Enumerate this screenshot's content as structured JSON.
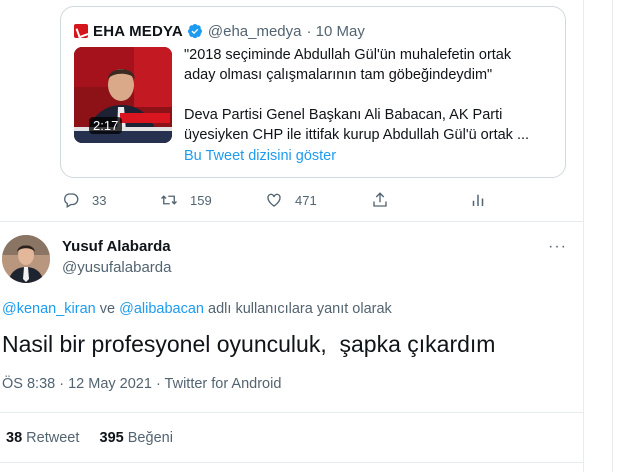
{
  "quoted": {
    "display_name": "EHA MEDYA",
    "handle": "@eha_medya",
    "date": "· 10 May",
    "video_duration": "2:17",
    "lines": [
      "\"2018 seçiminde Abdullah Gül'ün muhalefetin ortak",
      "aday olması çalışmalarının tam göbeğindeydim\"",
      "Deva Partisi Genel Başkanı Ali Babacan, AK Parti",
      "üyesiyken CHP ile ittifak kurup Abdullah Gül'ü ortak ..."
    ],
    "thread_link": "Bu Tweet dizisini göster"
  },
  "prev_actions": {
    "replies": "33",
    "retweets": "159",
    "likes": "471",
    "icons": [
      "reply-icon",
      "retweet-icon",
      "like-icon",
      "share-icon",
      "analytics-icon"
    ]
  },
  "tweet": {
    "display_name": "Yusuf Alabarda",
    "handle": "@yusufalabarda",
    "more": "···",
    "reply_to": {
      "mention1": "@kenan_kiran",
      "connector": "ve",
      "mention2": "@alibabacan",
      "suffix": "adlı kullanıcılara yanıt olarak"
    },
    "text": "Nasil bir profesyonel oyunculuk,  şapka çıkardım",
    "meta": "ÖS 8:38 · 12 May 2021 · Twitter for Android",
    "retweet_count": "38",
    "retweet_label": "Retweet",
    "like_count": "395",
    "like_label": "Beğeni"
  },
  "colors": {
    "link": "#1d9bf0",
    "secondary_text": "#536471",
    "border": "#cfd9de",
    "verified": "#1d9bf0"
  }
}
